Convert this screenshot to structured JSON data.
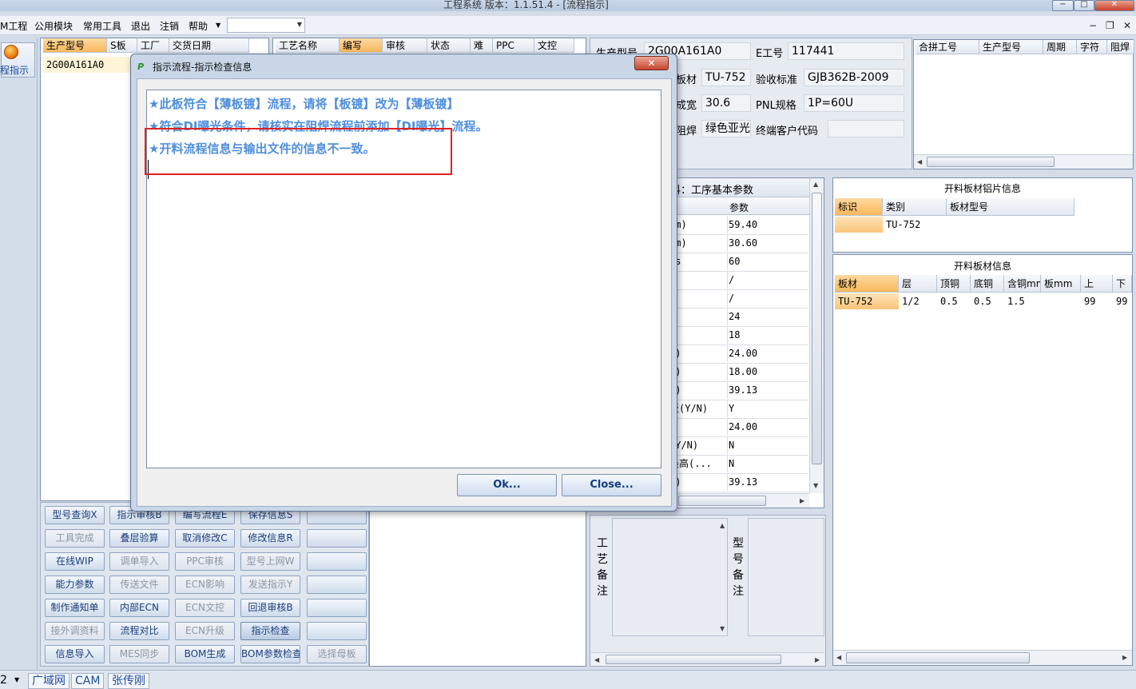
{
  "window": {
    "title": "工程系统   版本：1.1.51.4 - [流程指示]",
    "controls": [
      "−",
      "□",
      "✕"
    ]
  },
  "menubar": {
    "items": [
      "M工程",
      "公用模块",
      "常用工具",
      "退出",
      "注销",
      "帮助"
    ],
    "combo_value": "",
    "mdi_controls": [
      "−",
      "❐",
      "✕"
    ]
  },
  "leftnav": {
    "label": "程指示",
    "icon": "process-icon"
  },
  "order_list": {
    "headers": [
      "生产型号",
      "S板",
      "工厂",
      "交货日期"
    ],
    "rows": [
      {
        "model": "2G00A161A0",
        "s_board": "",
        "factory": "",
        "delivery": ""
      }
    ]
  },
  "process_list": {
    "headers": [
      "工艺名称",
      "编写",
      "审核",
      "状态",
      "难",
      "PPC",
      "文控"
    ]
  },
  "info_form": {
    "model_label": "生产型号",
    "model_value": "2G00A161A0",
    "eno_label": "E工号",
    "eno_value": "117441",
    "sheet_label": "板材",
    "sheet_value": "TU-752",
    "std_label": "验收标准",
    "std_value": "GJB362B-2009",
    "width_label": "成宽",
    "width_value": "30.6",
    "pnl_label": "PNL规格",
    "pnl_value": "1P=60U",
    "mask_label": "阻焊",
    "mask_value": "绿色亚光",
    "customer_label": "终端客户代码",
    "customer_value": ""
  },
  "merge_table": {
    "headers": [
      "合拼工号",
      "生产型号",
      "周期",
      "字符",
      "阻焊"
    ]
  },
  "params": {
    "section_title": "料：工序基本参数",
    "param_header": "参数",
    "rows": [
      {
        "k": "nm)",
        "v": "59.40"
      },
      {
        "k": "nm)",
        "v": "30.60"
      },
      {
        "k": "ts",
        "v": "60"
      },
      {
        "k": "s",
        "v": "/"
      },
      {
        "k": ":",
        "v": "/"
      },
      {
        "k": ")",
        "v": "24"
      },
      {
        "k": ")",
        "v": "18"
      },
      {
        "k": "')",
        "v": "24.00"
      },
      {
        "k": "')",
        "v": "18.00"
      },
      {
        "k": "%)",
        "v": "39.13"
      },
      {
        "k": "板(Y/N)",
        "v": "Y"
      },
      {
        "k": "",
        "v": "24.00"
      },
      {
        "k": "(Y/N)",
        "v": "N"
      },
      {
        "k": "最高(...",
        "v": "N"
      },
      {
        "k": "%)",
        "v": "39.13"
      }
    ]
  },
  "alu_info": {
    "title": "开料板材铝片信息",
    "headers": [
      "标识",
      "类别",
      "板材型号"
    ],
    "row": {
      "tag": "",
      "category": "TU-752",
      "sheet_model": ""
    }
  },
  "sheet_info": {
    "title": "开料板材信息",
    "headers": [
      "板材",
      "层",
      "顶铜",
      "底铜",
      "含铜mm",
      "板mm",
      "上",
      "下"
    ],
    "row": [
      "TU-752",
      "1/2",
      "0.5",
      "0.5",
      "1.5",
      "",
      "99",
      "99"
    ]
  },
  "remarks": {
    "process_label": [
      "工",
      "艺",
      "备",
      "注"
    ],
    "model_label": [
      "型",
      "号",
      "备",
      "注"
    ]
  },
  "buttons": [
    [
      "型号查询X",
      "指示审核B",
      "编写流程E",
      "保存信息S",
      ""
    ],
    [
      "工具完成",
      "叠层验算",
      "取消修改C",
      "修改信息R",
      ""
    ],
    [
      "在线WIP",
      "调单导入",
      "PPC审核",
      "型号上网W",
      ""
    ],
    [
      "能力参数",
      "传送文件",
      "ECN影响",
      "发送指示Y",
      ""
    ],
    [
      "制作通知单",
      "内部ECN",
      "ECN文控",
      "回退审核B",
      ""
    ],
    [
      "接外调资料",
      "流程对比",
      "ECN升级",
      "指示检查",
      ""
    ],
    [
      "信息导入",
      "MES同步",
      "BOM生成",
      "BOM参数检查",
      "选择母板"
    ]
  ],
  "statusbar": {
    "page": "2",
    "items": [
      "广域网",
      "CAM",
      "张传刚"
    ]
  },
  "dialog": {
    "title": "指示流程-指示检查信息",
    "messages": [
      "★此板符合【薄板镀】流程，请将【板镀】改为【薄板镀】",
      "★符合DI曝光条件，请核实在阻焊流程前添加【DI曝光】流程。",
      "★开料流程信息与输出文件的信息不一致。"
    ],
    "ok_label": "Ok...",
    "close_label": "Close...",
    "close_x": "✕"
  }
}
